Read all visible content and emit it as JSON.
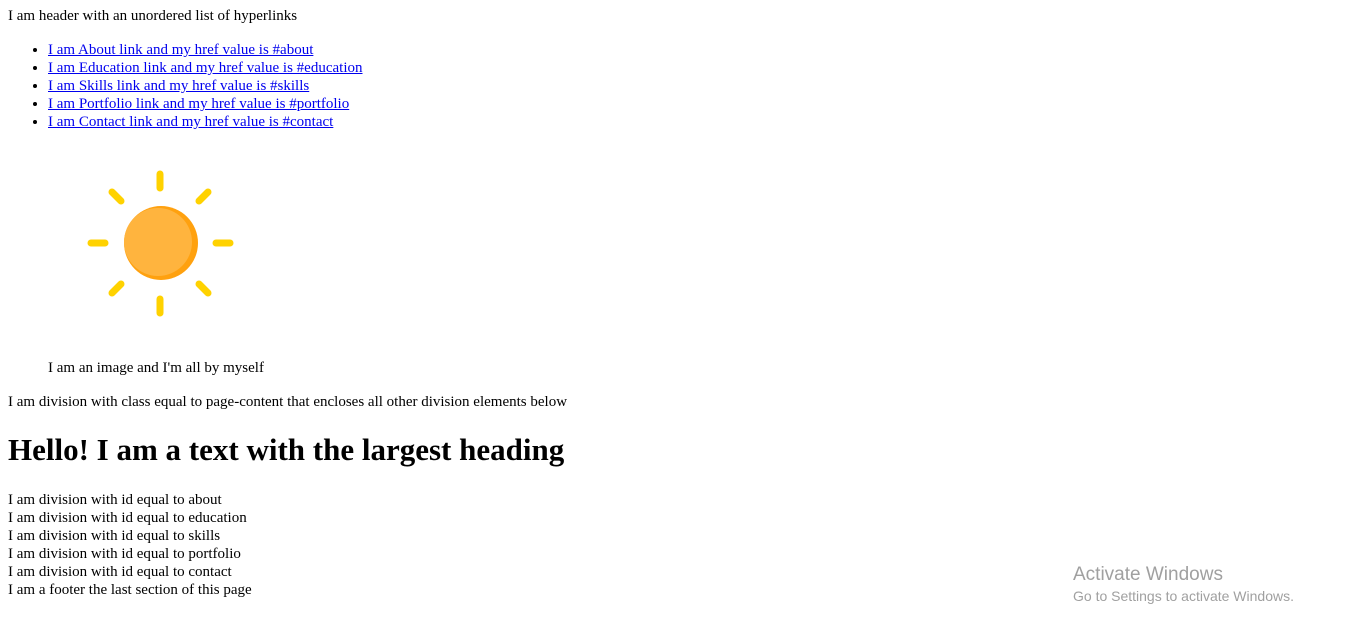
{
  "header": {
    "text": "I am header with an unordered list of hyperlinks"
  },
  "nav": {
    "links": [
      {
        "label": "I am About link and my href value is #about",
        "href": "#about"
      },
      {
        "label": "I am Education link and my href value is #education",
        "href": "#education"
      },
      {
        "label": "I am Skills link and my href value is #skills",
        "href": "#skills"
      },
      {
        "label": "I am Portfolio link and my href value is #portfolio",
        "href": "#portfolio"
      },
      {
        "label": "I am Contact link and my href value is #contact",
        "href": "#contact"
      }
    ]
  },
  "figure": {
    "icon": "sun-icon",
    "caption": "I am an image and I'm all by myself"
  },
  "page_content": {
    "text": "I am division with class equal to page-content that encloses all other division elements below",
    "heading": "Hello! I am a text with the largest heading",
    "divisions": [
      "I am division with id equal to about",
      "I am division with id equal to education",
      "I am division with id equal to skills",
      "I am division with id equal to portfolio",
      "I am division with id equal to contact"
    ]
  },
  "footer": {
    "text": "I am a footer the last section of this page"
  },
  "watermark": {
    "title": "Activate Windows",
    "subtitle": "Go to Settings to activate Windows."
  },
  "colors": {
    "link": "#0000ee",
    "sun_body": "#ffb43e",
    "sun_shade": "#ffa10f",
    "sun_rays": "#ffd200",
    "watermark": "#a0a0a0"
  }
}
